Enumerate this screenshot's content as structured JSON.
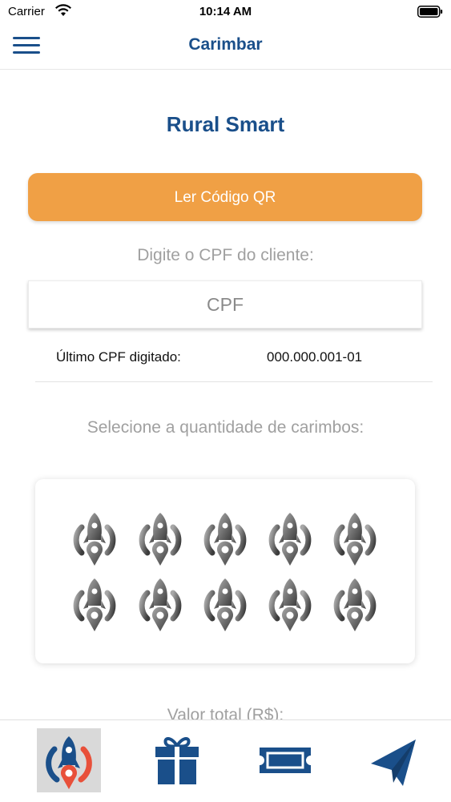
{
  "status_bar": {
    "carrier": "Carrier",
    "time": "10:14 AM"
  },
  "nav": {
    "title": "Carimbar",
    "menu_icon": "hamburger-menu-icon"
  },
  "main": {
    "store_name": "Rural Smart",
    "qr_button_label": "Ler Código QR",
    "cpf_prompt": "Digite o CPF do cliente:",
    "cpf_input": {
      "placeholder": "CPF",
      "value": ""
    },
    "last_cpf_label": "Último CPF digitado:",
    "last_cpf_value": "000.000.001-01",
    "stamps_prompt": "Selecione a quantidade de carimbos:",
    "stamps": {
      "count": 10,
      "selected": 0,
      "icon": "rocket-stamp-icon"
    },
    "total_label": "Valor total (R$):"
  },
  "tabs": [
    {
      "name": "stamp",
      "icon": "rocket-pin-icon",
      "active": true
    },
    {
      "name": "rewards",
      "icon": "gift-icon",
      "active": false
    },
    {
      "name": "tickets",
      "icon": "ticket-icon",
      "active": false
    },
    {
      "name": "send",
      "icon": "paper-plane-icon",
      "active": false
    }
  ],
  "colors": {
    "primary": "#1a4f8a",
    "accent_orange": "#f0a045",
    "tab_red": "#e8503a",
    "muted_text": "#a0a0a0"
  }
}
